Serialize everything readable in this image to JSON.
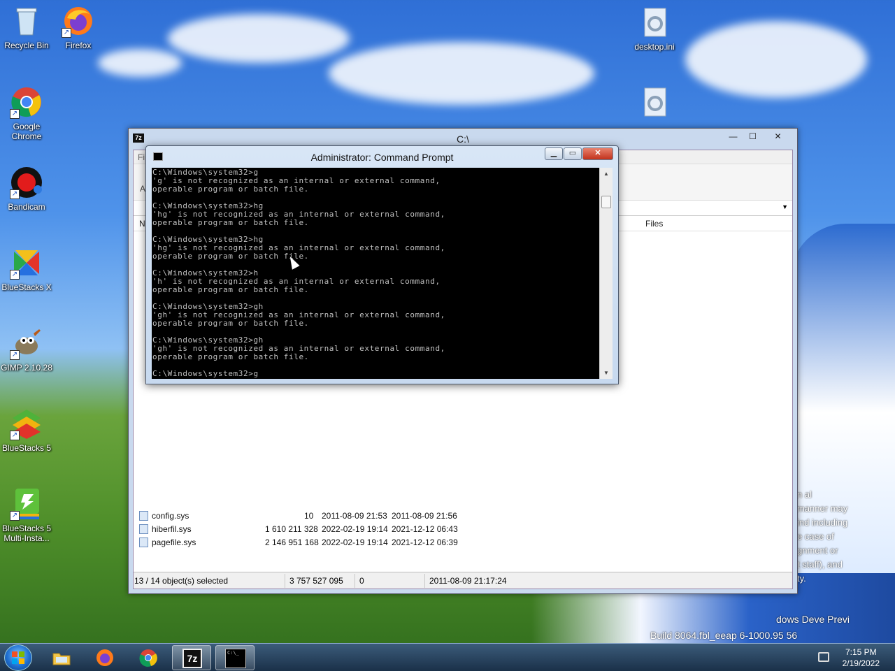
{
  "desktop": {
    "icons": [
      {
        "label": "Recycle Bin",
        "icon": "recycle-bin-icon"
      },
      {
        "label": "Firefox",
        "icon": "firefox-icon"
      },
      {
        "label": "Google Chrome",
        "icon": "chrome-icon"
      },
      {
        "label": "Bandicam",
        "icon": "bandicam-icon"
      },
      {
        "label": "BlueStacks X",
        "icon": "bluestacks-x-icon"
      },
      {
        "label": "GIMP 2.10.28",
        "icon": "gimp-icon"
      },
      {
        "label": "BlueStacks 5",
        "icon": "bluestacks-5-icon"
      },
      {
        "label": "BlueStacks 5 Multi-Insta...",
        "icon": "bluestacks-multi-icon"
      },
      {
        "label": "desktop.ini",
        "icon": "settings-file-icon"
      }
    ],
    "watermark": {
      "line1": "dows Deve       Previ",
      "line2": "Build 8064.fbl_eeap      6-1000.95     56",
      "overlay_lines": [
        "n al",
        "manner may",
        "ind including",
        "e case of",
        "gnment or",
        "t staff), and",
        "ty."
      ]
    }
  },
  "sevenzip": {
    "title": "C:\\",
    "app_badge": "7z",
    "buttons": {
      "minimize": "—",
      "maximize": "☐",
      "close": "✕"
    },
    "menu_fragment": "Fi",
    "column_fragment": "N",
    "side_fragment": "A",
    "column_header_files": "Files",
    "rows": [
      {
        "name": "config.sys",
        "size": "10",
        "modified": "2011-08-09 21:53",
        "created": "2011-08-09 21:56"
      },
      {
        "name": "hiberfil.sys",
        "size": "1 610 211 328",
        "modified": "2022-02-19 19:14",
        "created": "2021-12-12 06:43"
      },
      {
        "name": "pagefile.sys",
        "size": "2 146 951 168",
        "modified": "2022-02-19 19:14",
        "created": "2021-12-12 06:39"
      }
    ],
    "status": {
      "selected": "13 / 14 object(s) selected",
      "total_size": "3 757 527 095",
      "selected_size": "0",
      "date": "2011-08-09 21:17:24"
    }
  },
  "cmd": {
    "title": "Administrator: Command Prompt",
    "buttons": {
      "minimize": "▁",
      "maximize": "▭",
      "close": "✕"
    },
    "output": "C:\\Windows\\system32>g\n'g' is not recognized as an internal or external command,\noperable program or batch file.\n\nC:\\Windows\\system32>hg\n'hg' is not recognized as an internal or external command,\noperable program or batch file.\n\nC:\\Windows\\system32>hg\n'hg' is not recognized as an internal or external command,\noperable program or batch file.\n\nC:\\Windows\\system32>h\n'h' is not recognized as an internal or external command,\noperable program or batch file.\n\nC:\\Windows\\system32>gh\n'gh' is not recognized as an internal or external command,\noperable program or batch file.\n\nC:\\Windows\\system32>gh\n'gh' is not recognized as an internal or external command,\noperable program or batch file.\n\nC:\\Windows\\system32>g"
  },
  "taskbar": {
    "items": [
      {
        "icon": "start-orb-icon"
      },
      {
        "icon": "file-explorer-icon"
      },
      {
        "icon": "firefox-icon"
      },
      {
        "icon": "chrome-icon"
      },
      {
        "icon": "7zip-icon",
        "label": "7z"
      },
      {
        "icon": "cmd-icon",
        "label": "C:\\_"
      }
    ],
    "clock": {
      "time": "7:15 PM",
      "date": "2/19/2022"
    }
  }
}
